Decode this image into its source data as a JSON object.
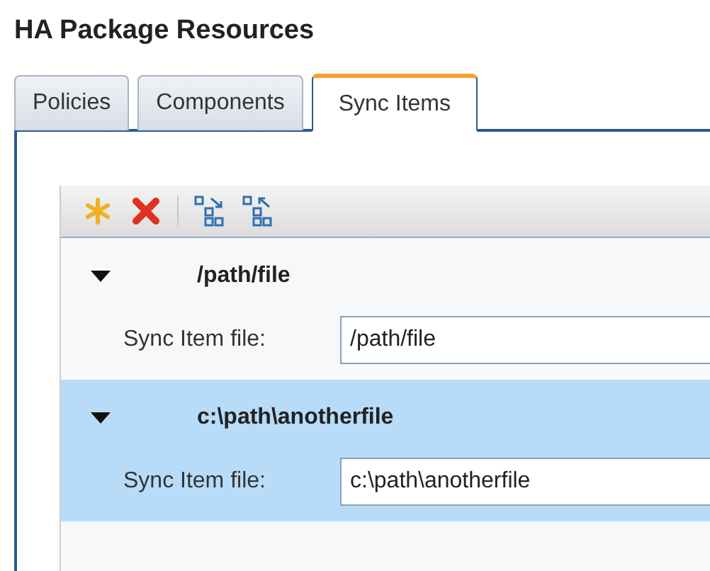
{
  "title": "HA Package Resources",
  "tabs": [
    {
      "label": "Policies",
      "selected": false
    },
    {
      "label": "Components",
      "selected": false
    },
    {
      "label": "Sync Items",
      "selected": true
    }
  ],
  "items": [
    {
      "name": "/path/file",
      "expanded": true,
      "selected": false,
      "field_label": "Sync Item file:",
      "value": "/path/file"
    },
    {
      "name": "c:\\path\\anotherfile",
      "expanded": true,
      "selected": true,
      "field_label": "Sync Item file:",
      "value": "c:\\path\\anotherfile"
    }
  ]
}
